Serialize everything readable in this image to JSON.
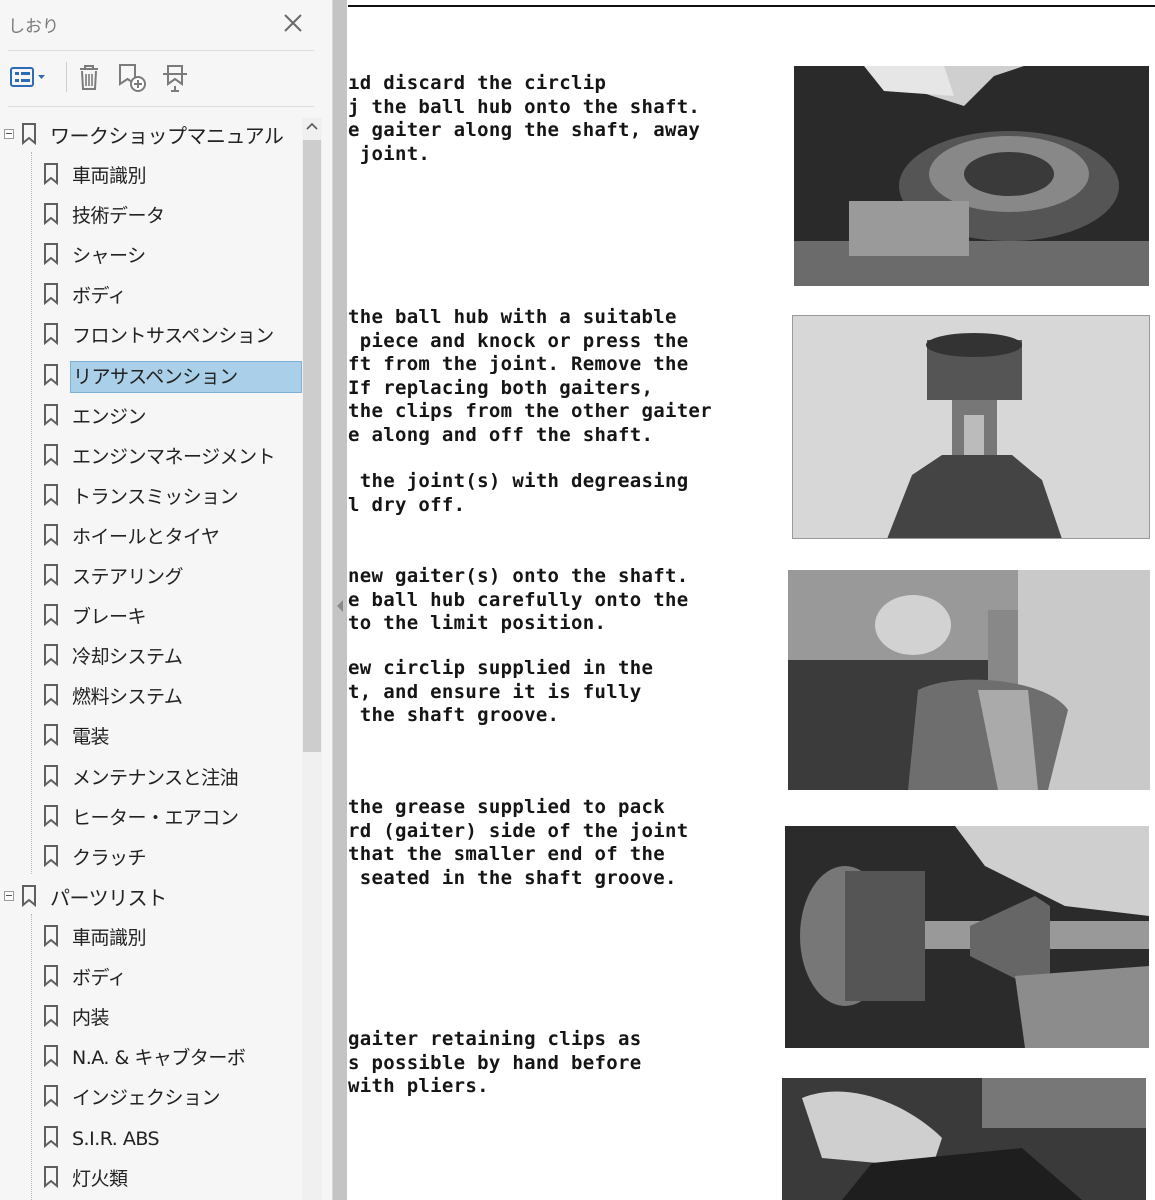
{
  "panel": {
    "title": "しおり",
    "close_icon": "close-icon",
    "toolbar": {
      "options_icon": "bookmark-options-icon",
      "delete_icon": "delete-icon",
      "new_bookmark_icon": "new-bookmark-icon",
      "find_bookmark_icon": "find-current-bookmark-icon"
    }
  },
  "bookmarks": {
    "workshop_manual": {
      "label": "ワークショップマニュアル",
      "children": [
        "車両識別",
        "技術データ",
        "シャーシ",
        "ボディ",
        "フロントサスペンション",
        "リアサスペンション",
        "エンジン",
        "エンジンマネージメント",
        "トランスミッション",
        "ホイールとタイヤ",
        "ステアリング",
        "ブレーキ",
        "冷却システム",
        "燃料システム",
        "電装",
        "メンテナンスと注油",
        "ヒーター・エアコン",
        "クラッチ"
      ]
    },
    "parts_list": {
      "label": "パーツリスト",
      "children": [
        "車両識別",
        "ボディ",
        "内装",
        "N.A. & キャブターボ",
        "インジェクション",
        "S.I.R. ABS",
        "灯火類"
      ]
    },
    "selected": "リアサスペンション"
  },
  "document": {
    "blocks": [
      [
        "ıd discard the circlip",
        "j the ball hub onto the shaft.",
        "e gaiter along the shaft, away",
        " joint."
      ],
      [
        "the ball hub with a suitable",
        " piece and knock or press the",
        "ft from the joint. Remove the",
        "If replacing both gaiters,",
        "the clips from the other gaiter",
        "e along and off the shaft."
      ],
      [
        " the joint(s) with degreasing",
        "l dry off."
      ],
      [
        "new gaiter(s) onto the shaft.",
        "e ball hub carefully onto the",
        "to the limit position."
      ],
      [
        "ew circlip supplied in the",
        "t, and ensure it is fully",
        " the shaft groove."
      ],
      [
        "the grease supplied to pack",
        "rd (gaiter) side of the joint",
        "that the smaller end of the",
        " seated in the shaft groove."
      ],
      [
        "gaiter retaining clips as",
        "s possible by hand before",
        "with pliers."
      ]
    ]
  }
}
